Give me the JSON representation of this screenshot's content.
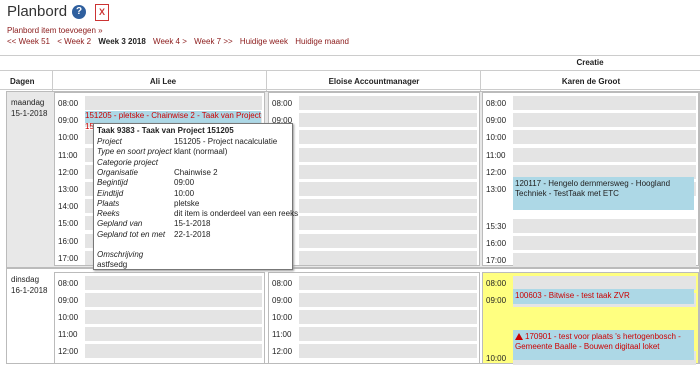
{
  "header": {
    "title": "Planbord",
    "help_icon": "question-circle-icon",
    "excel_icon": "excel-export-icon",
    "add_item": "Planbord item toevoegen »"
  },
  "week_nav": {
    "items": [
      "<< Week 51",
      "< Week 2",
      "Week 3 2018",
      "Week 4 >",
      "Week 7 >>",
      "Huidige week",
      "Huidige maand"
    ]
  },
  "group_header": "Creatie",
  "columns": {
    "days": "Dagen",
    "persons": [
      "Ali Lee",
      "Eloise Accountmanager",
      "Karen de Groot"
    ]
  },
  "days": [
    {
      "name": "maandag",
      "date": "15-1-2018"
    },
    {
      "name": "dinsdag",
      "date": "16-1-2018"
    }
  ],
  "times_a": [
    "08:00",
    "09:00",
    "10:00",
    "11:00",
    "12:00",
    "13:00",
    "14:00",
    "15:00",
    "16:00",
    "17:00"
  ],
  "times_karen_mon": [
    "08:00",
    "09:00",
    "10:00",
    "11:00",
    "12:00",
    "13:00",
    "15:30",
    "16:00",
    "17:00"
  ],
  "times_tue": [
    "08:00",
    "09:00",
    "10:00",
    "11:00",
    "12:00"
  ],
  "times_karen_tue": [
    "08:00",
    "09:00",
    "10:00"
  ],
  "appointments": {
    "ali_mon": "151205 - pletske - Chainwise 2 - Taak van Project",
    "ali_mon_short": "15",
    "karen_mon": "120117 - Hengelo dernmersweg - Hoogland Techniek - TestTaak met ETC",
    "karen_tue_1": "100603 - Bitwise - test taak ZVR",
    "karen_tue_2": "170901 - test voor plaats 's hertogenbosch - Gemeente Baalle - Bouwen digitaal loket"
  },
  "tooltip": {
    "title": "Taak 9383 - Taak van Project 151205",
    "rows": [
      {
        "k": "Project",
        "v": "151205 - Project nacalculatie"
      },
      {
        "k": "Type en soort project",
        "v": "klant (normaal)"
      },
      {
        "k": "Categorie project",
        "v": ""
      },
      {
        "k": "Organisatie",
        "v": "Chainwise 2"
      },
      {
        "k": "Begintijd",
        "v": "09:00"
      },
      {
        "k": "Eindtijd",
        "v": "10:00"
      },
      {
        "k": "Plaats",
        "v": "pletske"
      },
      {
        "k": "Reeks",
        "v": "dit item is onderdeel van een reeks"
      },
      {
        "k": "Gepland van",
        "v": "15-1-2018"
      },
      {
        "k": "Gepland tot en met",
        "v": "22-1-2018"
      },
      {
        "k": "Omschrijving",
        "v": ""
      }
    ],
    "description": "astfsedg"
  },
  "colors": {
    "link": "#8b1a1a",
    "appt_blue": "#add8e6",
    "appt_yellow": "#ffff80",
    "warning": "#cc0000"
  }
}
